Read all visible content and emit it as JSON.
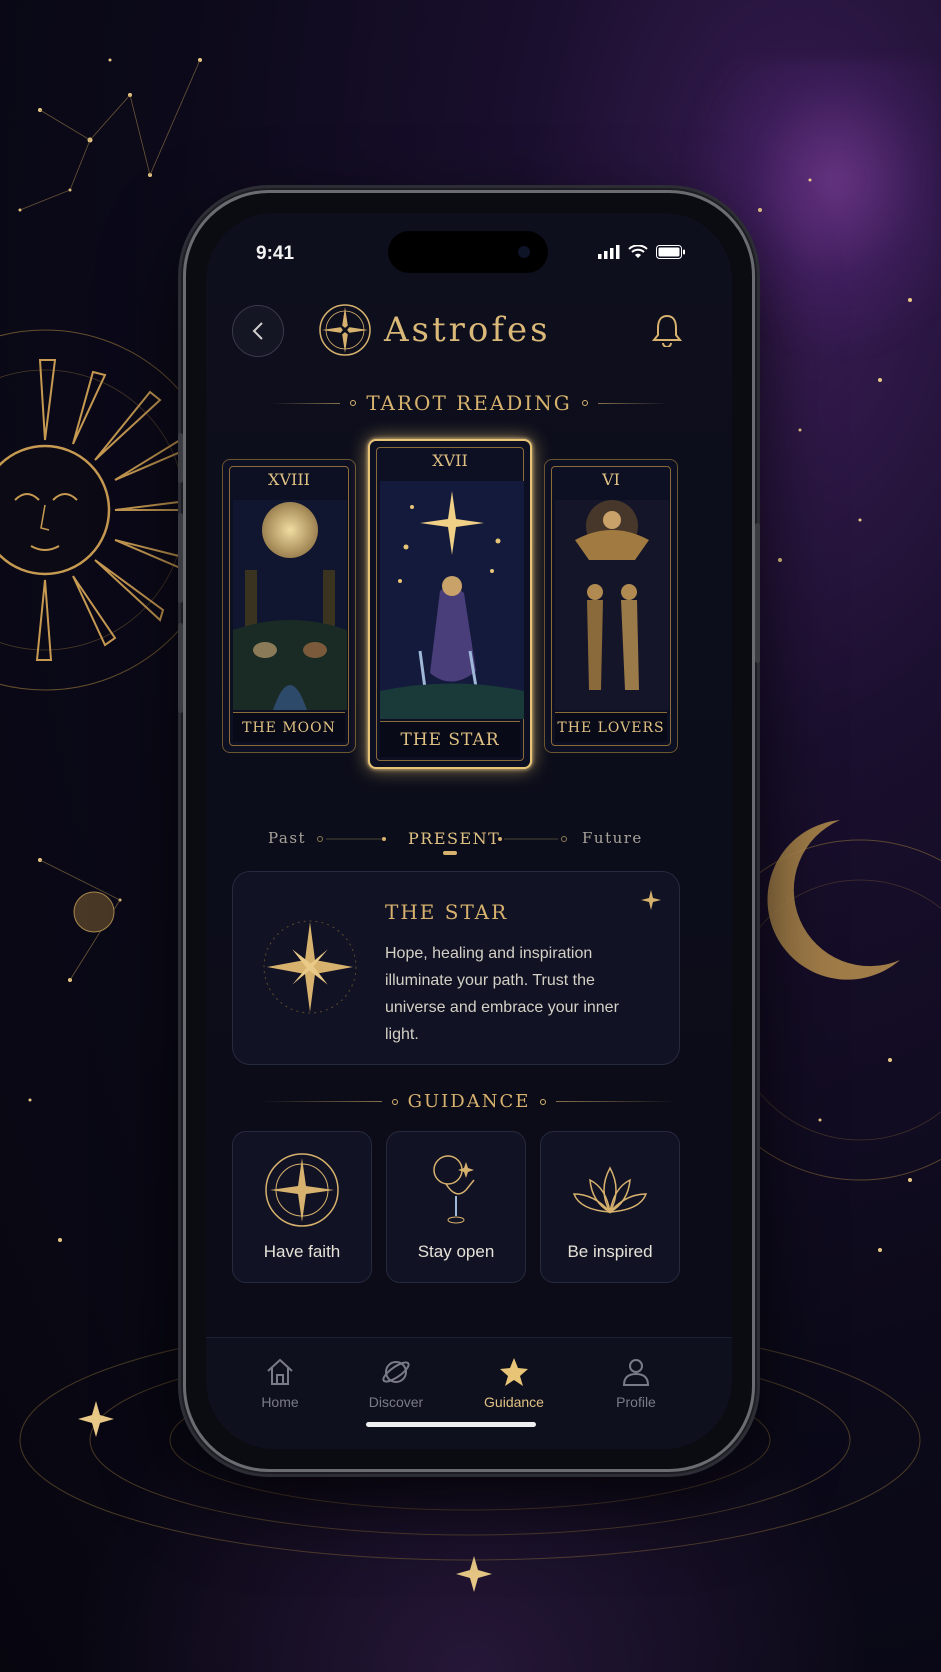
{
  "status": {
    "time": "9:41"
  },
  "header": {
    "brand": "Astrofes"
  },
  "reading": {
    "title": "TAROT READING",
    "cards": [
      {
        "numeral": "XVIII",
        "name": "THE MOON"
      },
      {
        "numeral": "XVII",
        "name": "THE STAR"
      },
      {
        "numeral": "VI",
        "name": "THE LOVERS"
      }
    ],
    "positions": {
      "past": "Past",
      "present": "PRESENT",
      "future": "Future"
    }
  },
  "detail": {
    "title": "THE STAR",
    "text": "Hope, healing and inspiration illuminate your path. Trust the universe and embrace your inner light."
  },
  "guidance": {
    "title": "GUIDANCE",
    "items": [
      {
        "label": "Have faith",
        "icon": "compass-star-icon"
      },
      {
        "label": "Stay open",
        "icon": "water-bearer-icon"
      },
      {
        "label": "Be inspired",
        "icon": "lotus-icon"
      }
    ]
  },
  "tabs": [
    {
      "label": "Home",
      "icon": "home-icon"
    },
    {
      "label": "Discover",
      "icon": "planet-icon"
    },
    {
      "label": "Guidance",
      "icon": "star-icon"
    },
    {
      "label": "Profile",
      "icon": "user-icon"
    }
  ],
  "colors": {
    "gold": "#d7b26e",
    "background": "#0c0d1a",
    "active_glow": "#e8c477"
  }
}
